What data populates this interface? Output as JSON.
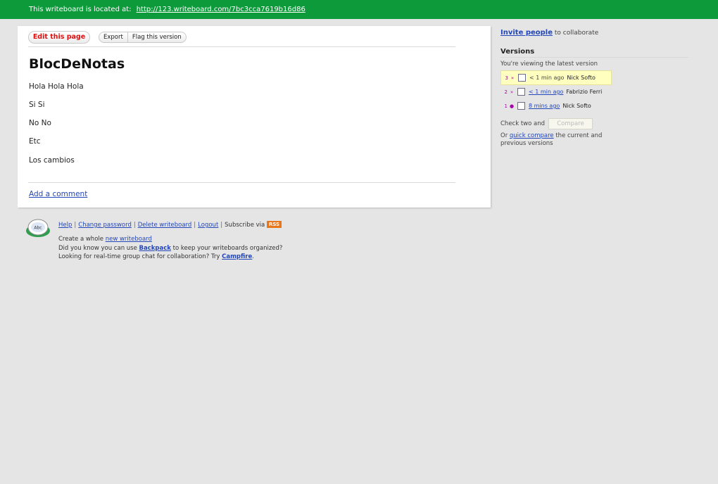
{
  "topbar": {
    "label": "This writeboard is located at:",
    "url": "http://123.writeboard.com/7bc3cca7619b16d86"
  },
  "toolbar": {
    "edit_label": "Edit this page",
    "export_label": "Export",
    "flag_label": "Flag this version"
  },
  "document": {
    "title": "BlocDeNotas",
    "paragraphs": [
      "Hola Hola Hola",
      "Si Si",
      "No No",
      "Etc",
      "Los cambios"
    ],
    "add_comment": "Add a comment"
  },
  "sidebar": {
    "invite_link": "Invite people",
    "invite_suffix": "to collaborate",
    "versions_heading": "Versions",
    "viewing_text": "You're viewing the latest version",
    "versions": [
      {
        "num": "3",
        "mark": "»",
        "ago": "< 1 min ago",
        "author": "Nick Softo",
        "link": false
      },
      {
        "num": "2",
        "mark": "»",
        "ago": "< 1 min ago",
        "author": "Fabrizio Ferri",
        "link": true
      },
      {
        "num": "1",
        "mark": "●",
        "ago": "8 mins ago",
        "author": "Nick Softo",
        "link": true
      }
    ],
    "check_two": "Check two and",
    "compare_label": "Compare",
    "quick_prefix": "Or",
    "quick_link": "quick compare",
    "quick_suffix": "the current and previous versions"
  },
  "footer": {
    "logo_text": "Abc",
    "links": [
      "Help",
      "Change password",
      "Delete writeboard",
      "Logout"
    ],
    "subscribe": "Subscribe via",
    "rss": "RSS",
    "create_prefix": "Create a whole",
    "create_link": "new writeboard",
    "backpack_prefix": "Did you know you can use",
    "backpack_link": "Backpack",
    "backpack_suffix": "to keep your writeboards organized?",
    "campfire_prefix": "Looking for real-time group chat for collaboration? Try",
    "campfire_link": "Campfire",
    "campfire_suffix": "."
  },
  "colors": {
    "topbar_bg": "#0d9a3a",
    "link": "#2346b8",
    "edit_button_text": "#e01010",
    "highlight_row": "#ffffc0",
    "rss_badge": "#e8761a"
  }
}
